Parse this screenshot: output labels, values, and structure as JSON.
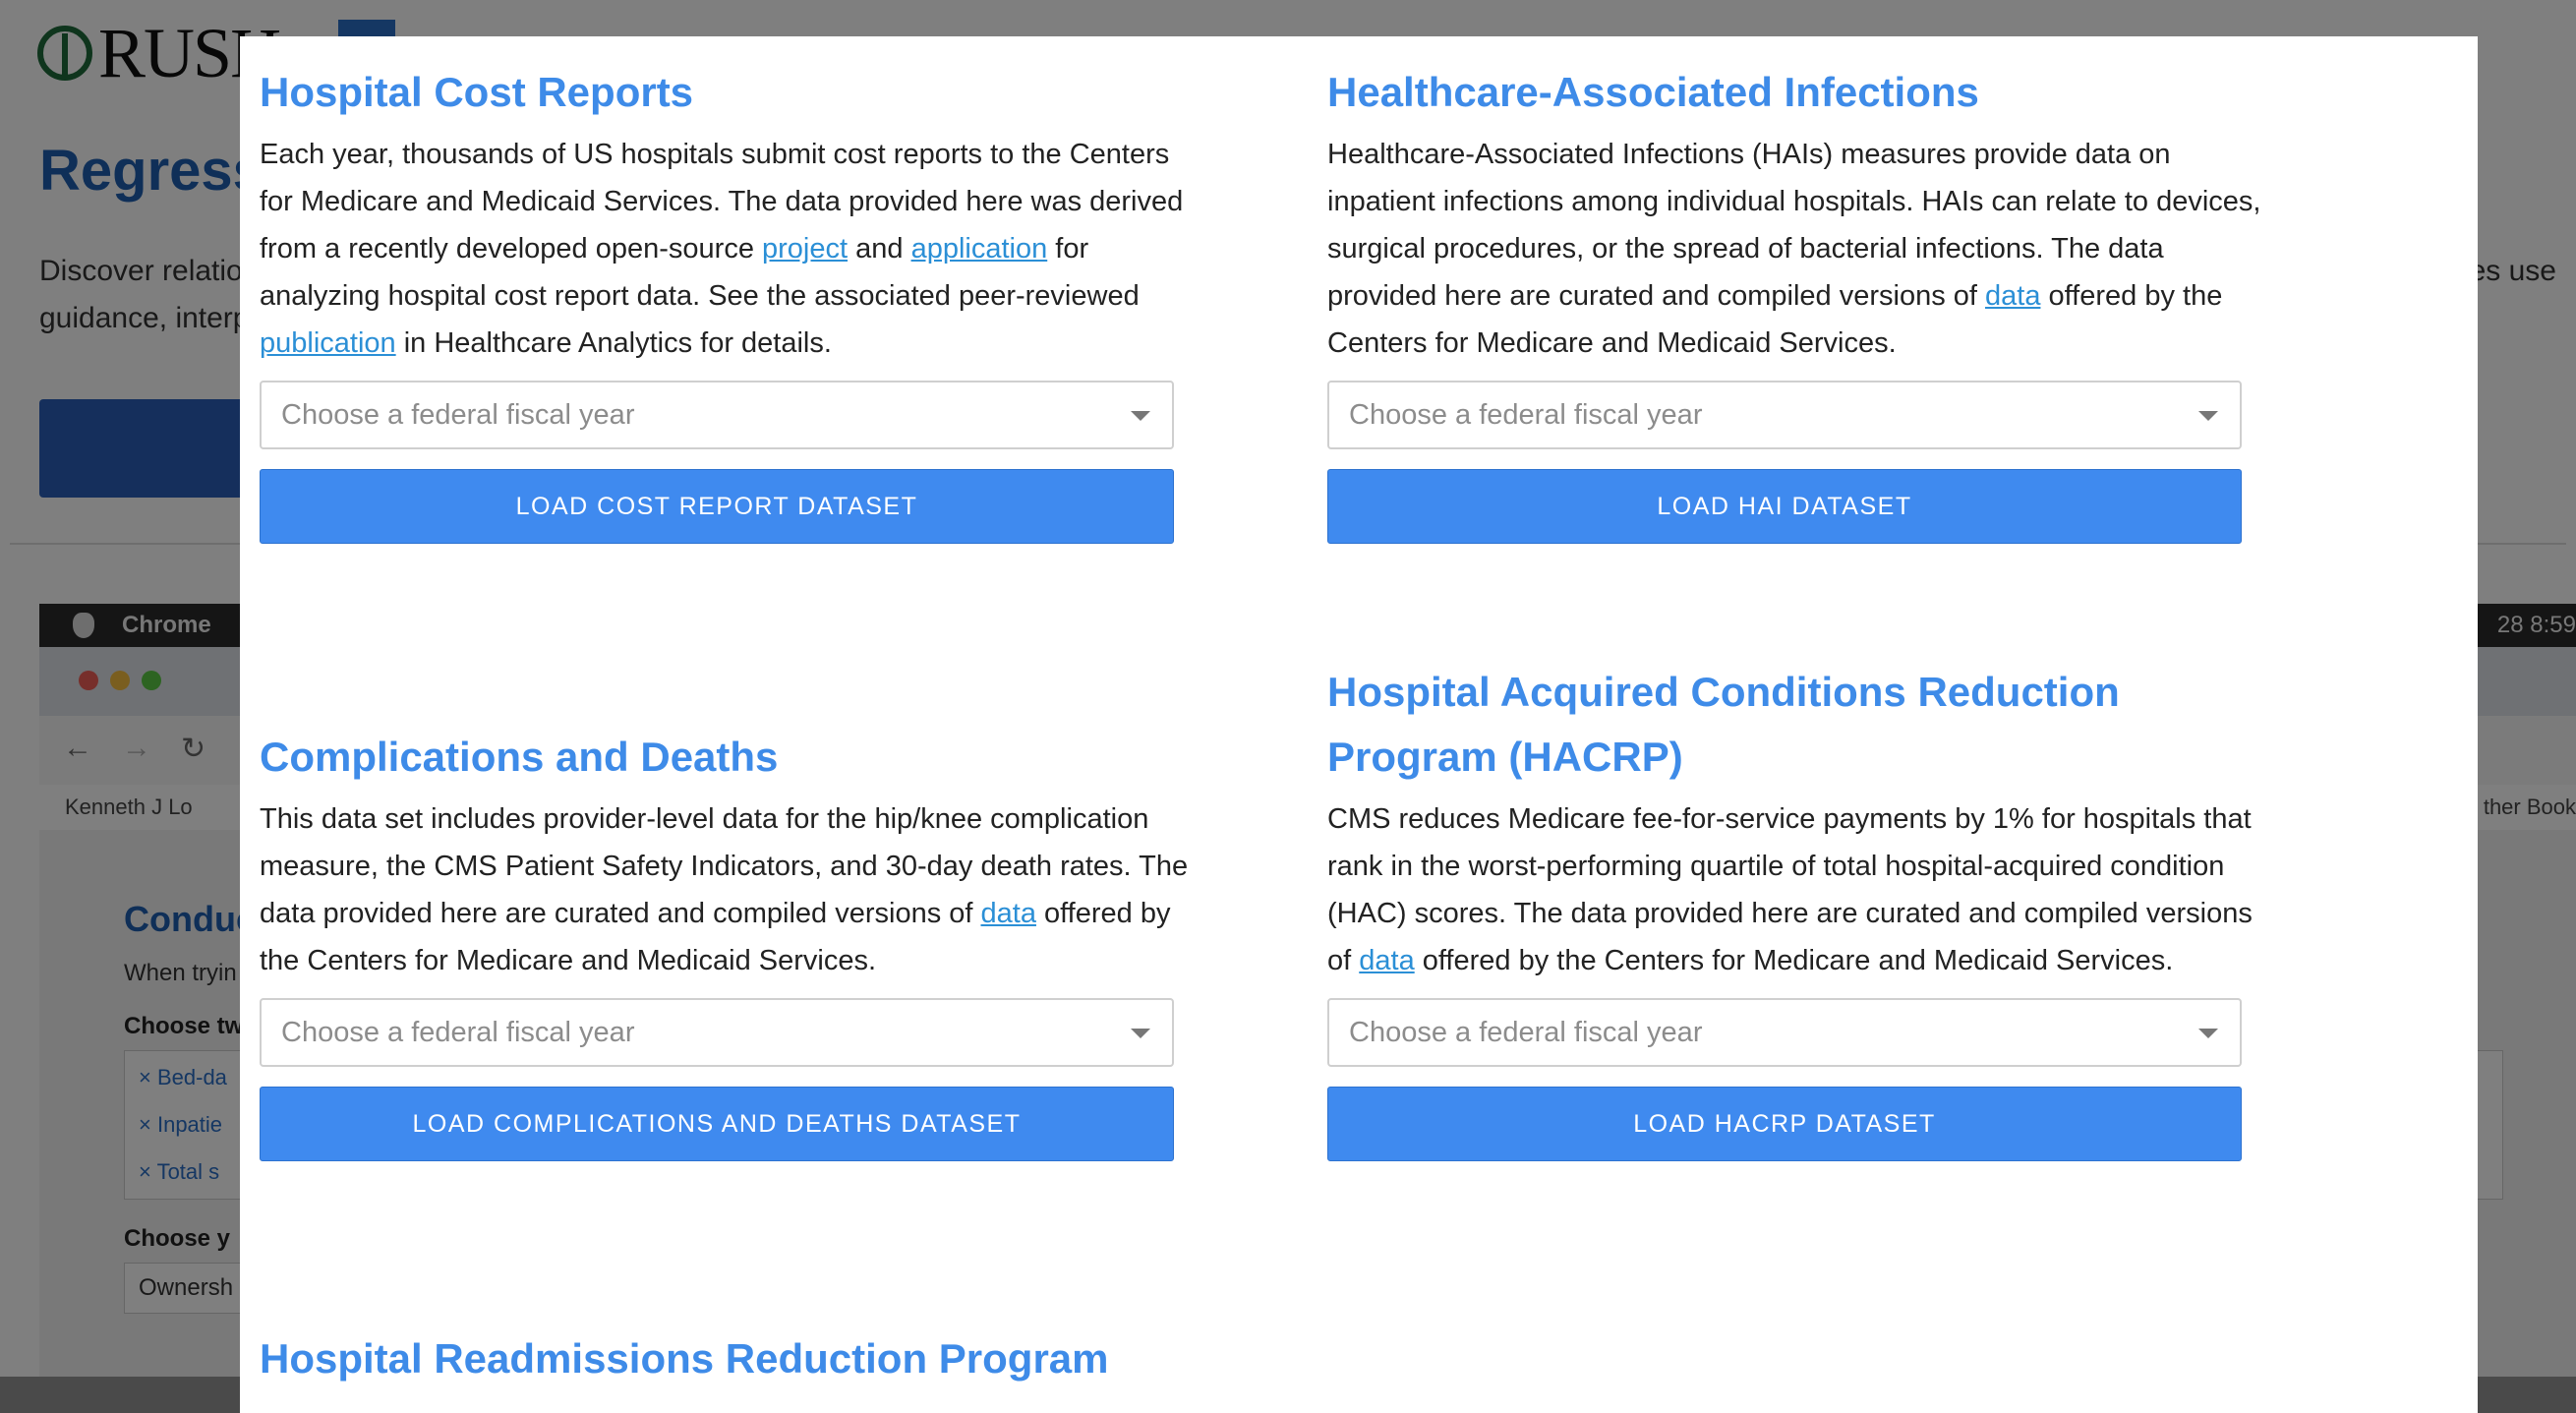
{
  "background": {
    "logo_text": "RUSH",
    "page_title": "Regress",
    "desc_line1": "Discover relatio",
    "desc_line2": "guidance, interp",
    "desc_right": "des use",
    "mac_app": "Chrome",
    "mac_clock": "28  8:59",
    "bookmark_left": "Kenneth J Lo",
    "bookmark_right": "ther Book",
    "inner_heading": "Conduc",
    "inner_text": "When tryin",
    "choose_two_label": "Choose tw",
    "chips": [
      "Bed-da",
      "Inpatie",
      "Total s"
    ],
    "choose_y_label": "Choose y",
    "select_value": "Ownersh"
  },
  "modal": {
    "sections": [
      {
        "title": "Hospital Cost Reports",
        "body": [
          {
            "t": "Each year, thousands of US hospitals submit cost reports to the Centers for Medicare and Medicaid Services. The data provided here was derived from a recently developed open-source "
          },
          {
            "t": "project",
            "link": true
          },
          {
            "t": " and "
          },
          {
            "t": "application",
            "link": true
          },
          {
            "t": " for analyzing hospital cost report data. See the associated peer-reviewed "
          },
          {
            "t": "publication",
            "link": true
          },
          {
            "t": " in Healthcare Analytics for details."
          }
        ],
        "placeholder": "Choose a federal fiscal year",
        "button": "LOAD COST REPORT DATASET"
      },
      {
        "title": "Healthcare-Associated Infections",
        "body": [
          {
            "t": "Healthcare-Associated Infections (HAIs) measures provide data on inpatient infections among individual hospitals. HAIs can relate to devices, surgical procedures, or the spread of bacterial infections. The data provided here are curated and compiled versions of "
          },
          {
            "t": "data",
            "link": true
          },
          {
            "t": " offered by the Centers for Medicare and Medicaid Services."
          }
        ],
        "placeholder": "Choose a federal fiscal year",
        "button": "LOAD HAI DATASET"
      },
      {
        "title": "Complications and Deaths",
        "body": [
          {
            "t": "This data set includes provider-level data for the hip/knee complication measure, the CMS Patient Safety Indicators, and 30-day death rates. The data provided here are curated and compiled versions of "
          },
          {
            "t": "data",
            "link": true
          },
          {
            "t": " offered by the Centers for Medicare and Medicaid Services."
          }
        ],
        "placeholder": "Choose a federal fiscal year",
        "button": "LOAD COMPLICATIONS AND DEATHS DATASET"
      },
      {
        "title": "Hospital Acquired Conditions Reduction Program (HACRP)",
        "body": [
          {
            "t": "CMS reduces Medicare fee-for-service payments by 1% for hospitals that rank in the worst-performing quartile of total hospital-acquired condition (HAC) scores. The data provided here are curated and compiled versions of "
          },
          {
            "t": "data",
            "link": true
          },
          {
            "t": " offered by the Centers for Medicare and Medicaid Services."
          }
        ],
        "placeholder": "Choose a federal fiscal year",
        "button": "LOAD HACRP DATASET"
      },
      {
        "title": "Hospital Readmissions Reduction Program"
      }
    ]
  },
  "colors": {
    "heading": "#3e8be8",
    "button": "#3f8aef",
    "link": "#2b8fd6"
  }
}
